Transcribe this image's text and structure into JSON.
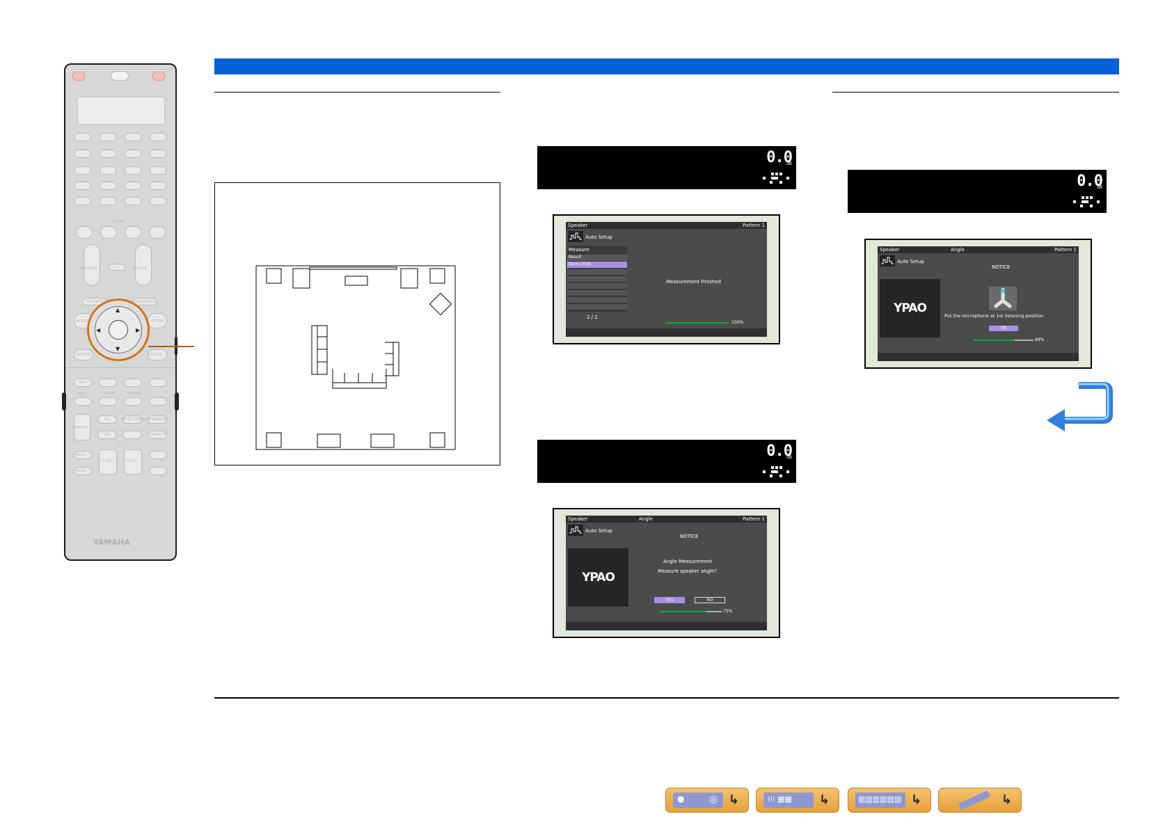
{
  "remote": {
    "brand": "YAMAHA",
    "labels": {
      "scene": "SCENE",
      "program": "PROGRAM",
      "volume": "VOLUME",
      "top_menu": "TOP MENU",
      "popup_menu": "POP-UP/MENU",
      "on_screen": "ON SCREEN",
      "option": "OPTION",
      "return": "RETURN",
      "display": "DISPLAY",
      "info": "INFO",
      "mem": "MEM",
      "preset": "PRESET",
      "tuning": "TUNING",
      "band": "BAND",
      "fm": "FM",
      "am": "AM",
      "pure_direct": "PURE DIRECT",
      "enhancer": "ENHANCER",
      "straight": "STRAIGHT",
      "input": "INPUT",
      "mute": "MUTE",
      "tv": "TV",
      "tv_vol": "TV VOL",
      "tv_ch": "TV CH"
    }
  },
  "colors": {
    "topbar": "#0a61d6",
    "highlight": "#a98fe0",
    "progress": "#00b53a",
    "return_arrow": "#3b8ee8"
  },
  "icons": {
    "return_arrow": "return-arrow-icon",
    "ypao_logo": "ypao-logo"
  },
  "displays": {
    "volume": "0.0",
    "unit": "dB"
  },
  "screen1": {
    "left_header": "Speaker",
    "right_header": "Pattern 1",
    "title": "Auto Setup",
    "menu_heading": "Measure",
    "menu_items": [
      "Result",
      "Save / Exit"
    ],
    "page": "2 / 2",
    "message": "Measurement Finished",
    "progress_percent": 100,
    "progress_label": "100%"
  },
  "screen2": {
    "left_header": "Speaker",
    "mid_header": "Angle",
    "right_header": "Pattern 1",
    "title": "Auto Setup",
    "notice": "NOTICE",
    "logo": "YPAO",
    "line1": "Angle Measurement",
    "line2": "Measure speaker angle?",
    "yes": "YES",
    "no": "NO",
    "progress_percent": 75,
    "progress_label": "75%"
  },
  "screen3": {
    "left_header": "Speaker",
    "mid_header": "Angle",
    "right_header": "Pattern 1",
    "title": "Auto Setup",
    "notice": "NOTICE",
    "logo": "YPAO",
    "message": "Put the microphone at 1st listening position",
    "ok": "OK",
    "progress_percent": 69,
    "progress_label": "69%"
  }
}
